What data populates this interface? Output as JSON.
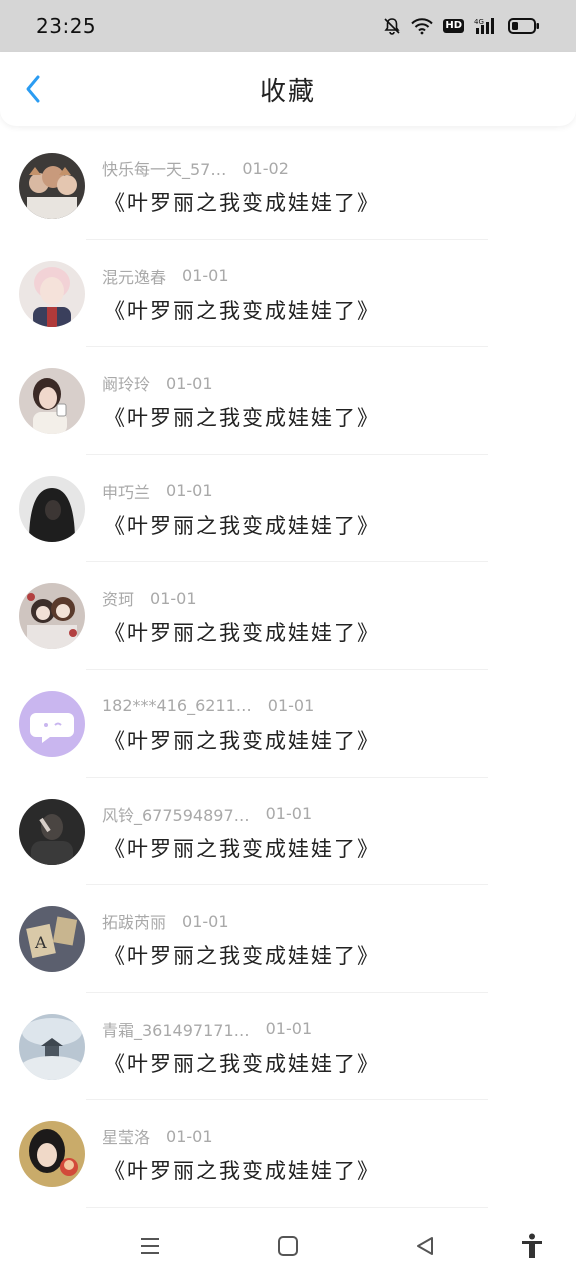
{
  "status_bar": {
    "time": "23:25",
    "hd_label": "HD",
    "network_label": "4G",
    "icons": [
      "mute-bell-icon",
      "wifi-icon",
      "hd-icon",
      "signal-icon",
      "battery-icon"
    ]
  },
  "header": {
    "title": "收藏",
    "back_icon": "chevron-left-icon",
    "accent": "#2b9cf2"
  },
  "favorites": [
    {
      "name": "快乐每一天_57…",
      "date": "01-02",
      "title": "《叶罗丽之我变成娃娃了》",
      "avatar": "group-photo-avatar"
    },
    {
      "name": "混元逸春",
      "date": "01-01",
      "title": "《叶罗丽之我变成娃娃了》",
      "avatar": "pink-hair-avatar"
    },
    {
      "name": "阚玲玲",
      "date": "01-01",
      "title": "《叶罗丽之我变成娃娃了》",
      "avatar": "girl-with-cup-avatar"
    },
    {
      "name": "申巧兰",
      "date": "01-01",
      "title": "《叶罗丽之我变成娃娃了》",
      "avatar": "hooded-figure-avatar"
    },
    {
      "name": "资珂",
      "date": "01-01",
      "title": "《叶罗丽之我变成娃娃了》",
      "avatar": "anime-art-avatar"
    },
    {
      "name": "182***416_6211…",
      "date": "01-01",
      "title": "《叶罗丽之我变成娃娃了》",
      "avatar": "default-chat-avatar"
    },
    {
      "name": "风铃_677594897…",
      "date": "01-01",
      "title": "《叶罗丽之我变成娃娃了》",
      "avatar": "dark-portrait-avatar"
    },
    {
      "name": "拓跋芮丽",
      "date": "01-01",
      "title": "《叶罗丽之我变成娃娃了》",
      "avatar": "vintage-letters-avatar"
    },
    {
      "name": "青霜_361497171…",
      "date": "01-01",
      "title": "《叶罗丽之我变成娃娃了》",
      "avatar": "misty-landscape-avatar"
    },
    {
      "name": "星莹洛",
      "date": "01-01",
      "title": "《叶罗丽之我变成娃娃了》",
      "avatar": "selfie-avatar"
    }
  ],
  "nav_bar": {
    "icons": [
      "menu-icon",
      "home-square-icon",
      "back-triangle-icon",
      "accessibility-icon"
    ]
  }
}
